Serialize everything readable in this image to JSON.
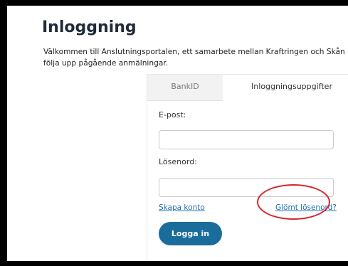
{
  "page": {
    "title": "Inloggning",
    "intro_line1": "Välkommen till Anslutningsportalen, ett samarbete mellan Kraftringen och Skån",
    "intro_line2": "följa upp pågående anmälningar."
  },
  "login": {
    "tabs": [
      {
        "label": "BankID",
        "active": false
      },
      {
        "label": "Inloggningsuppgifter",
        "active": true
      }
    ],
    "email_label": "E-post:",
    "email_value": "",
    "password_label": "Lösenord:",
    "password_value": "",
    "create_account_link": "Skapa konto",
    "forgot_password_link": "Glömt lösenord?",
    "login_button": "Logga in"
  },
  "colors": {
    "accent": "#1a6d9b",
    "link": "#1e6fa8",
    "highlight": "#d9252b",
    "title": "#1f2a3a"
  }
}
